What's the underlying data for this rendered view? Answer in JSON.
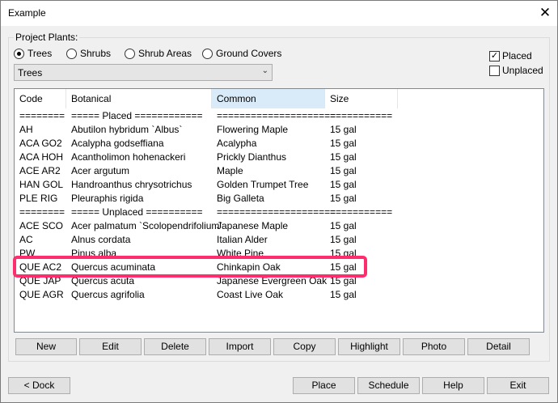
{
  "window": {
    "title": "Example"
  },
  "group": {
    "label": "Project Plants:"
  },
  "radios": [
    {
      "label": "Trees",
      "selected": true
    },
    {
      "label": "Shrubs",
      "selected": false
    },
    {
      "label": "Shrub Areas",
      "selected": false
    },
    {
      "label": "Ground Covers",
      "selected": false
    }
  ],
  "checks": [
    {
      "label": "Placed",
      "checked": true
    },
    {
      "label": "Unplaced",
      "checked": false
    }
  ],
  "combo": {
    "value": "Trees"
  },
  "columns": [
    "Code",
    "Botanical",
    "Common",
    "Size"
  ],
  "rows": [
    [
      "========",
      "===== Placed ============",
      "=====================",
      "==========="
    ],
    [
      "AH",
      "Abutilon hybridum `Albus`",
      "Flowering Maple",
      "15 gal"
    ],
    [
      "ACA GO2",
      "Acalypha godseffiana",
      "Acalypha",
      "15 gal"
    ],
    [
      "ACA HOH",
      "Acantholimon hohenackeri",
      "Prickly Dianthus",
      "15 gal"
    ],
    [
      "ACE AR2",
      "Acer argutum",
      "Maple",
      "15 gal"
    ],
    [
      "HAN GOL",
      "Handroanthus chrysotrichus",
      "Golden Trumpet Tree",
      "15 gal"
    ],
    [
      "PLE RIG",
      "Pleuraphis rigida",
      "Big Galleta",
      "15 gal"
    ],
    [
      "========",
      "===== Unplaced ==========",
      "=====================",
      "==========="
    ],
    [
      "ACE SCO",
      "Acer palmatum `Scolopendrifolium`",
      "Japanese Maple",
      "15 gal"
    ],
    [
      "AC",
      "Alnus cordata",
      "Italian Alder",
      "15 gal"
    ],
    [
      "PW",
      "Pinus alba",
      "White Pine",
      "15 gal"
    ],
    [
      "QUE AC2",
      "Quercus acuminata",
      "Chinkapin Oak",
      "15 gal"
    ],
    [
      "QUE JAP",
      "Quercus acuta",
      "Japanese Evergreen Oak",
      "15 gal"
    ],
    [
      "QUE AGR",
      "Quercus agrifolia",
      "Coast Live Oak",
      "15 gal"
    ]
  ],
  "list_buttons": [
    "New",
    "Edit",
    "Delete",
    "Import",
    "Copy",
    "Highlight",
    "Photo",
    "Detail"
  ],
  "bottom": {
    "dock": "< Dock",
    "place": "Place",
    "schedule": "Schedule",
    "help": "Help",
    "exit": "Exit"
  },
  "close_glyph": "✕",
  "highlight_color": "#ff2d6e",
  "sorted_header_color": "#d9ebf9"
}
